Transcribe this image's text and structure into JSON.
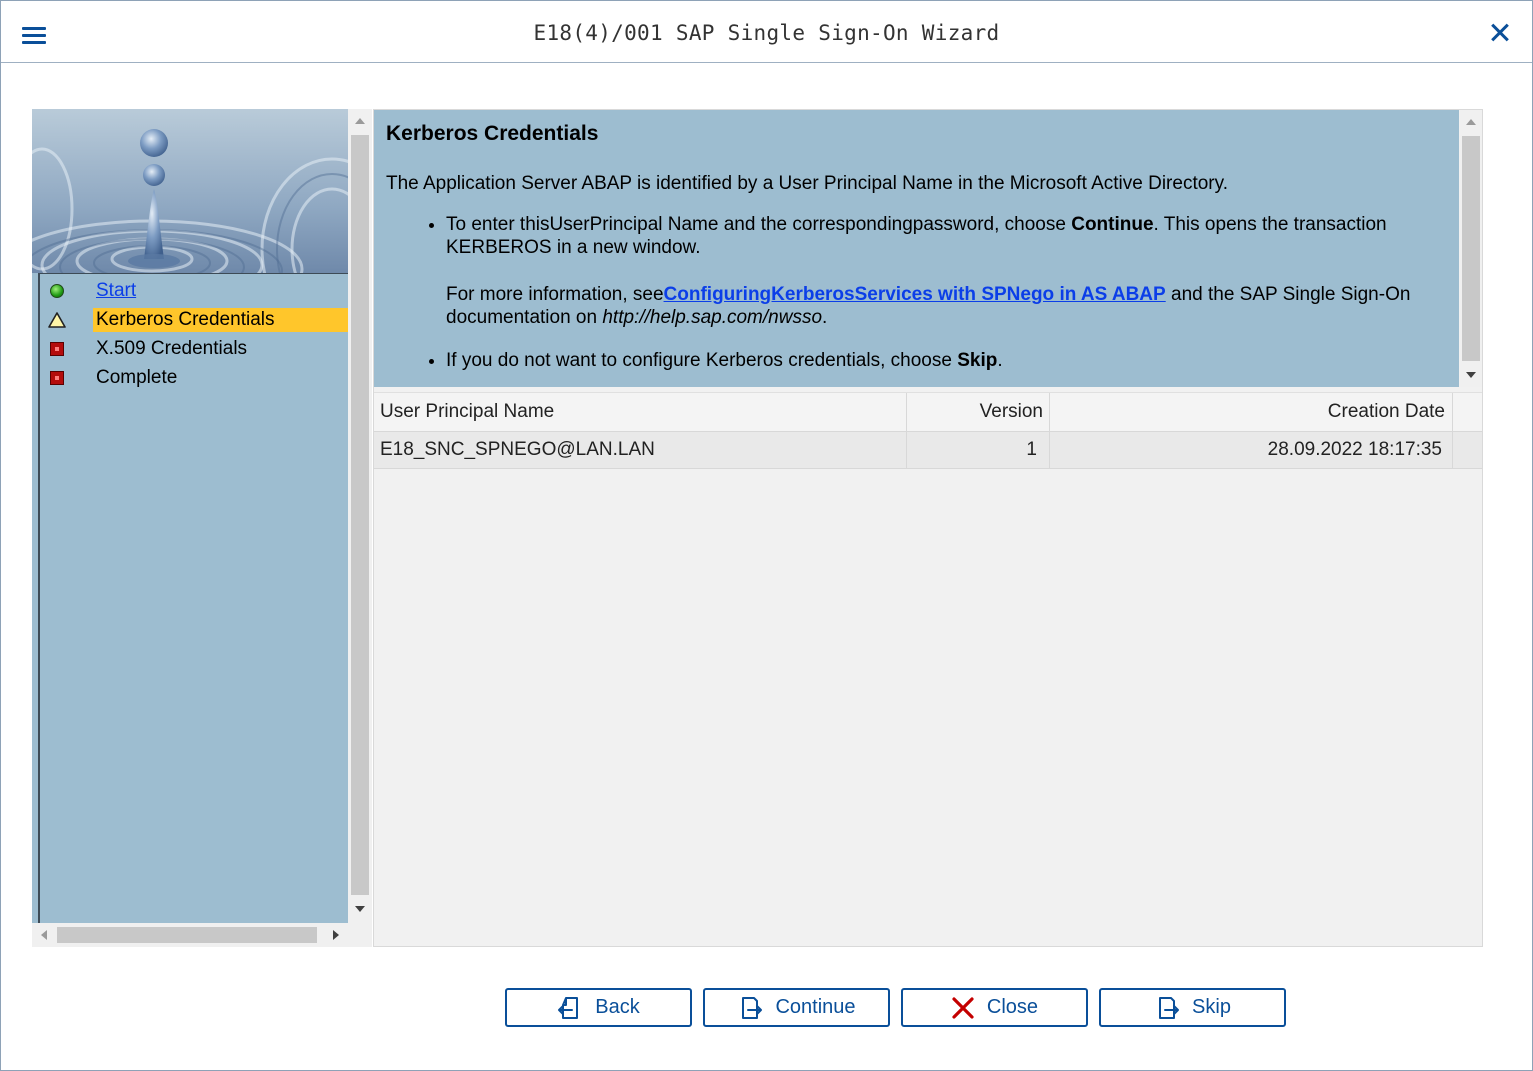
{
  "window": {
    "title": "E18(4)/001 SAP Single Sign-On Wizard"
  },
  "nav": {
    "items": [
      {
        "label": "Start",
        "status": "done",
        "icon": "green-circle-icon"
      },
      {
        "label": "Kerberos Credentials",
        "status": "current",
        "icon": "warning-triangle-icon"
      },
      {
        "label": "X.509 Credentials",
        "status": "pending",
        "icon": "red-square-icon"
      },
      {
        "label": "Complete",
        "status": "pending",
        "icon": "red-square-icon"
      }
    ]
  },
  "info": {
    "heading": "Kerberos Credentials",
    "intro": "The Application Server ABAP is identified by a User Principal Name in the Microsoft Active Directory.",
    "bullet1": {
      "text_a": "To enter thisUserPrincipal Name and the correspondingpassword, choose ",
      "bold": "Continue",
      "text_b": ". This opens the transaction KERBEROS in a new window.",
      "more_a": "For more information, see",
      "link": "ConfiguringKerberosServices with SPNego in AS ABAP",
      "more_b": " and the SAP Single Sign-On documentation on ",
      "url": "http://help.sap.com/nwsso",
      "more_c": "."
    },
    "bullet2": {
      "text_a": "If you do not want to configure Kerberos credentials, choose ",
      "bold": "Skip",
      "text_b": "."
    }
  },
  "table": {
    "columns": [
      "User Principal Name",
      "Version",
      "Creation Date"
    ],
    "rows": [
      [
        "E18_SNC_SPNEGO@LAN.LAN",
        "1",
        "28.09.2022 18:17:35"
      ]
    ]
  },
  "buttons": {
    "back": "Back",
    "continue": "Continue",
    "close": "Close",
    "skip": "Skip"
  },
  "colors": {
    "accent": "#0a4f99",
    "pane_bg": "#9dbdd0",
    "highlight": "#ffc62b",
    "link": "#0b3ee8",
    "close_icon": "#c40000"
  }
}
